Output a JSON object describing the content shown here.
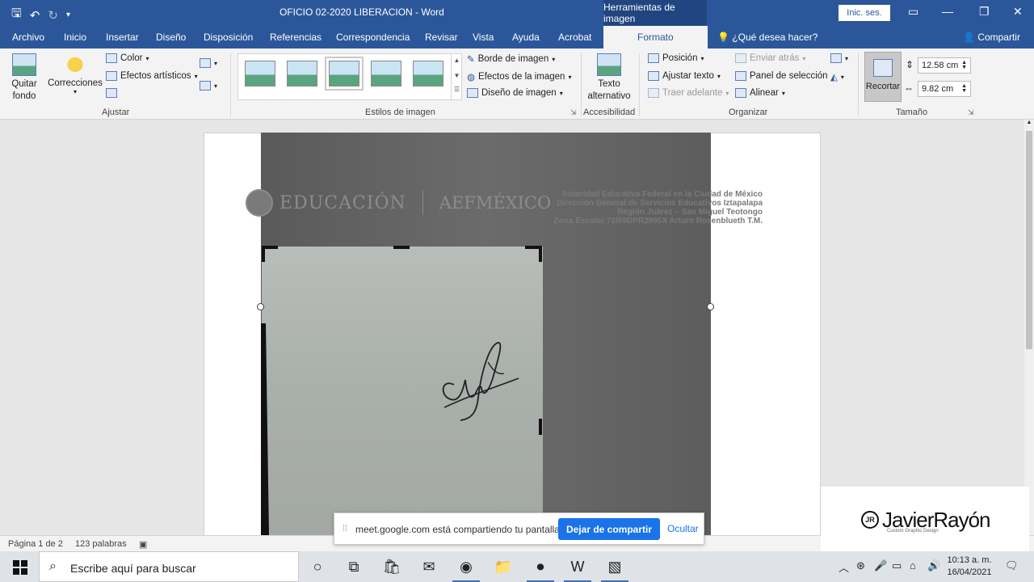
{
  "titlebar": {
    "doc_title": "OFICIO 02-2020 LIBERACION  -  Word",
    "context_tools": "Herramientas de imagen",
    "signin": "Inic. ses."
  },
  "tabs": [
    "Archivo",
    "Inicio",
    "Insertar",
    "Diseño",
    "Disposición",
    "Referencias",
    "Correspondencia",
    "Revisar",
    "Vista",
    "Ayuda",
    "Acrobat"
  ],
  "active_tab": "Formato",
  "tell_me": "¿Qué desea hacer?",
  "share": "Compartir",
  "ribbon": {
    "ajustar": {
      "label": "Ajustar",
      "remove_bg": "Quitar fondo",
      "corrections": "Correcciones",
      "color": "Color",
      "artistic": "Efectos artísticos"
    },
    "styles": {
      "label": "Estilos de imagen",
      "border": "Borde de imagen",
      "effects": "Efectos de la imagen",
      "layout": "Diseño de imagen"
    },
    "accessibility": {
      "label": "Accesibilidad",
      "alt_text_1": "Texto",
      "alt_text_2": "alternativo"
    },
    "arrange": {
      "label": "Organizar",
      "position": "Posición",
      "wrap": "Ajustar texto",
      "bring_forward": "Traer adelante",
      "send_back": "Enviar atrás",
      "selection_pane": "Panel de selección",
      "align": "Alinear"
    },
    "size": {
      "label": "Tamaño",
      "crop": "Recortar",
      "height": "12.58 cm",
      "width": "9.82 cm"
    }
  },
  "document": {
    "logo_main": "EDUCACIÓN",
    "logo_aef": "AEFMÉXICO",
    "header_lines": [
      "Autoridad Educativa Federal en la Ciudad de México",
      "Dirección General de Servicios Educativos Iztapalapa",
      "Región Juárez – San Miguel Teotongo",
      "Zona Escolar 72/09DPR2995X Arturo Rosenblueth T.M."
    ]
  },
  "statusbar": {
    "page": "Página 1 de 2",
    "words": "123 palabras"
  },
  "share_bar": {
    "message": "meet.google.com está compartiendo tu pantalla.",
    "stop": "Dejar de compartir",
    "hide": "Ocultar"
  },
  "watermark": {
    "name": "JavierRayón",
    "initials": "JR",
    "sub": "Custom Graphic Design"
  },
  "taskbar": {
    "search_placeholder": "Escribe aquí para buscar",
    "time": "10:13 a. m.",
    "date": "16/04/2021",
    "apps": [
      "cortana-icon",
      "task-view-icon",
      "store-icon",
      "mail-icon",
      "chrome-icon",
      "file-explorer-icon",
      "recorder-icon",
      "word-icon",
      "photos-icon"
    ]
  },
  "colors": {
    "accent": "#2b579a",
    "share_button": "#1a73e8"
  }
}
